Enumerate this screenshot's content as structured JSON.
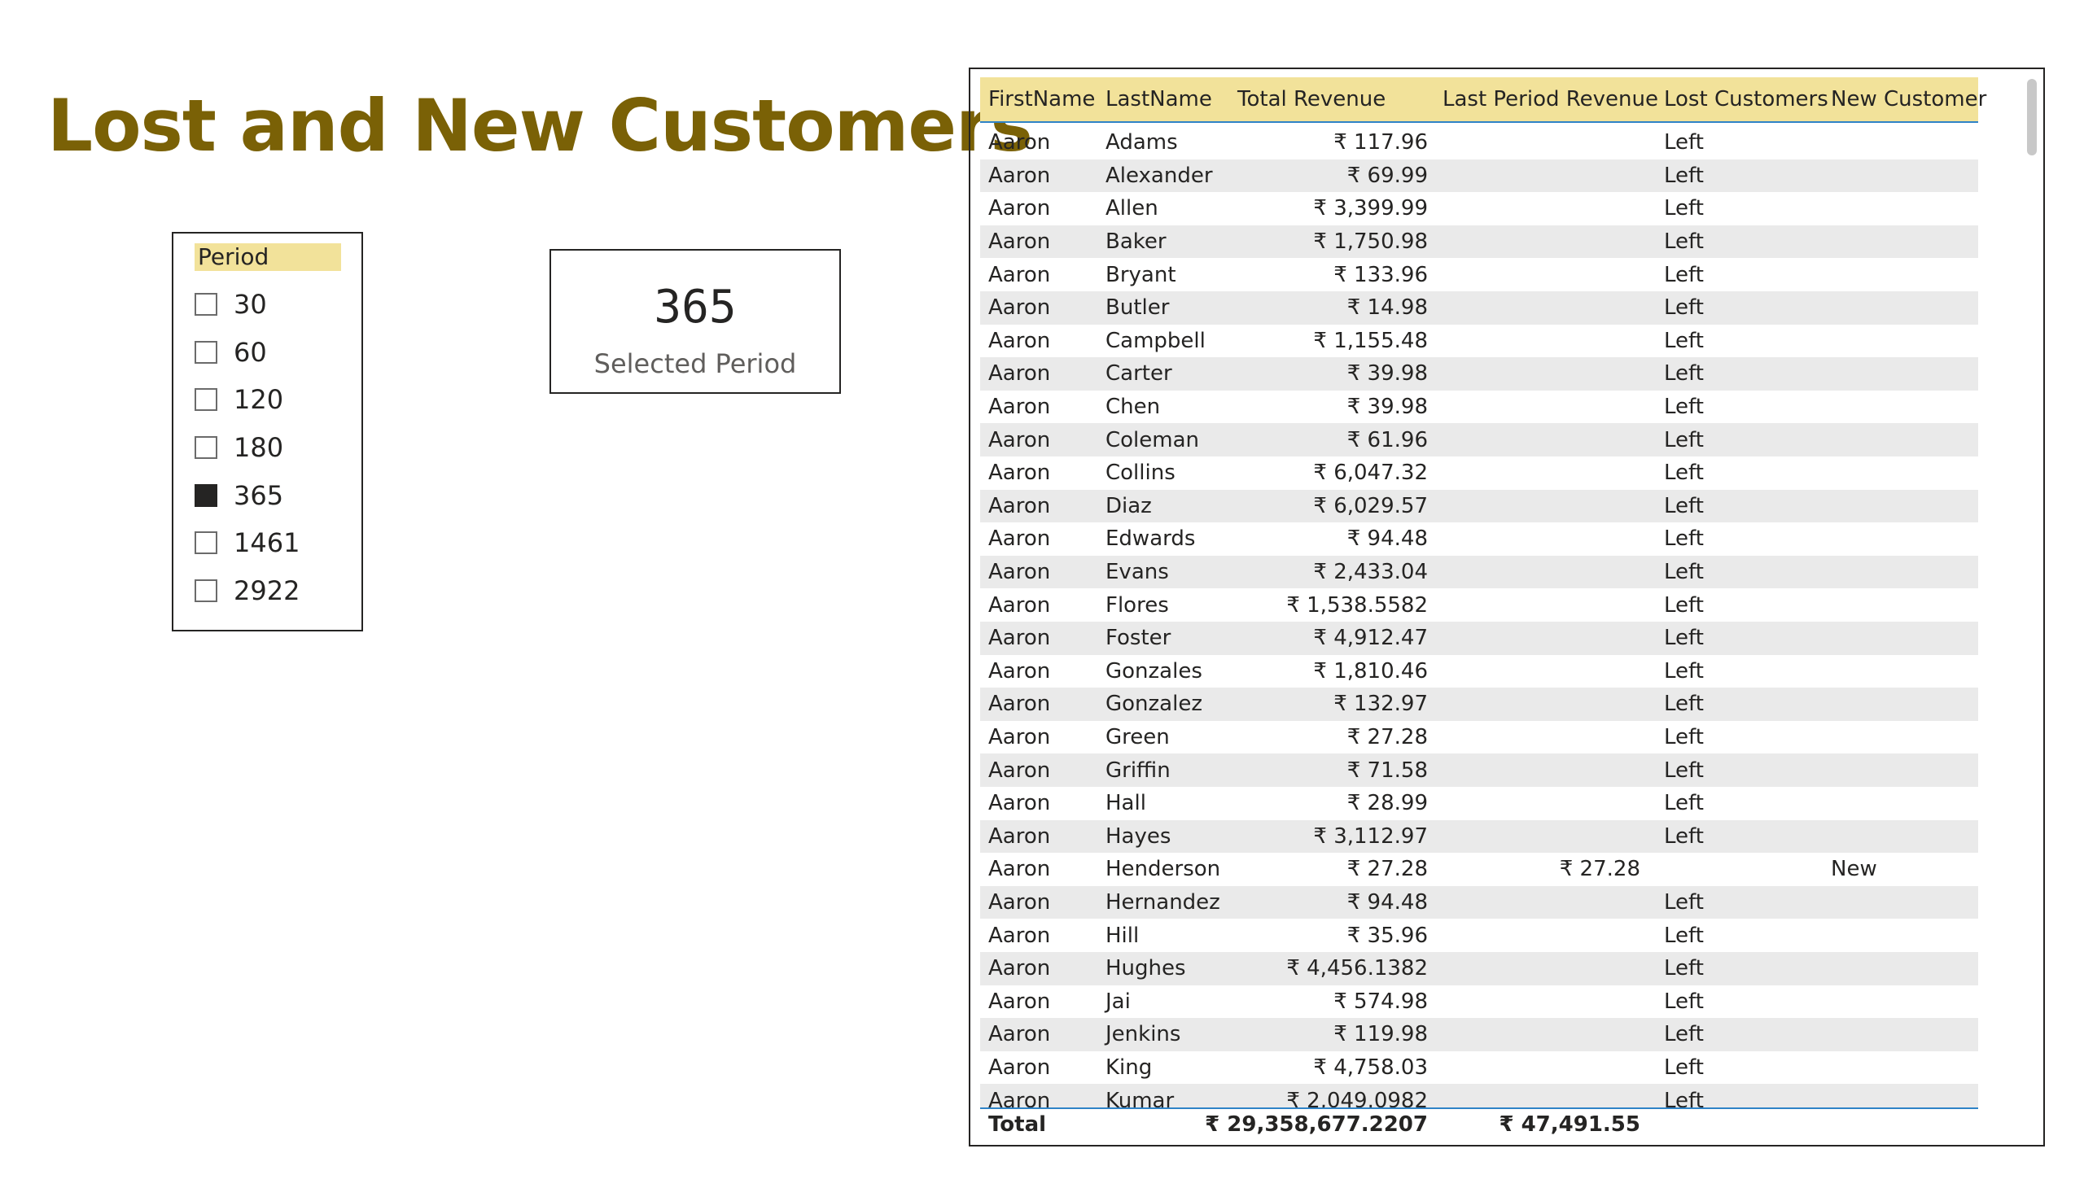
{
  "page": {
    "title": "Lost and New Customers"
  },
  "slicer": {
    "header": "Period",
    "items": [
      {
        "label": "30",
        "checked": false
      },
      {
        "label": "60",
        "checked": false
      },
      {
        "label": "120",
        "checked": false
      },
      {
        "label": "180",
        "checked": false
      },
      {
        "label": "365",
        "checked": true
      },
      {
        "label": "1461",
        "checked": false
      },
      {
        "label": "2922",
        "checked": false
      }
    ]
  },
  "card": {
    "value": "365",
    "label": "Selected Period"
  },
  "table": {
    "headers": [
      "FirstName",
      "LastName",
      "Total Revenue",
      "Last Period Revenue",
      "Lost Customers",
      "New Customer"
    ],
    "rows": [
      [
        "Aaron",
        "Adams",
        "₹ 117.96",
        "",
        "Left",
        ""
      ],
      [
        "Aaron",
        "Alexander",
        "₹ 69.99",
        "",
        "Left",
        ""
      ],
      [
        "Aaron",
        "Allen",
        "₹ 3,399.99",
        "",
        "Left",
        ""
      ],
      [
        "Aaron",
        "Baker",
        "₹ 1,750.98",
        "",
        "Left",
        ""
      ],
      [
        "Aaron",
        "Bryant",
        "₹ 133.96",
        "",
        "Left",
        ""
      ],
      [
        "Aaron",
        "Butler",
        "₹ 14.98",
        "",
        "Left",
        ""
      ],
      [
        "Aaron",
        "Campbell",
        "₹ 1,155.48",
        "",
        "Left",
        ""
      ],
      [
        "Aaron",
        "Carter",
        "₹ 39.98",
        "",
        "Left",
        ""
      ],
      [
        "Aaron",
        "Chen",
        "₹ 39.98",
        "",
        "Left",
        ""
      ],
      [
        "Aaron",
        "Coleman",
        "₹ 61.96",
        "",
        "Left",
        ""
      ],
      [
        "Aaron",
        "Collins",
        "₹ 6,047.32",
        "",
        "Left",
        ""
      ],
      [
        "Aaron",
        "Diaz",
        "₹ 6,029.57",
        "",
        "Left",
        ""
      ],
      [
        "Aaron",
        "Edwards",
        "₹ 94.48",
        "",
        "Left",
        ""
      ],
      [
        "Aaron",
        "Evans",
        "₹ 2,433.04",
        "",
        "Left",
        ""
      ],
      [
        "Aaron",
        "Flores",
        "₹ 1,538.5582",
        "",
        "Left",
        ""
      ],
      [
        "Aaron",
        "Foster",
        "₹ 4,912.47",
        "",
        "Left",
        ""
      ],
      [
        "Aaron",
        "Gonzales",
        "₹ 1,810.46",
        "",
        "Left",
        ""
      ],
      [
        "Aaron",
        "Gonzalez",
        "₹ 132.97",
        "",
        "Left",
        ""
      ],
      [
        "Aaron",
        "Green",
        "₹ 27.28",
        "",
        "Left",
        ""
      ],
      [
        "Aaron",
        "Griffin",
        "₹ 71.58",
        "",
        "Left",
        ""
      ],
      [
        "Aaron",
        "Hall",
        "₹ 28.99",
        "",
        "Left",
        ""
      ],
      [
        "Aaron",
        "Hayes",
        "₹ 3,112.97",
        "",
        "Left",
        ""
      ],
      [
        "Aaron",
        "Henderson",
        "₹ 27.28",
        "₹ 27.28",
        "",
        "New"
      ],
      [
        "Aaron",
        "Hernandez",
        "₹ 94.48",
        "",
        "Left",
        ""
      ],
      [
        "Aaron",
        "Hill",
        "₹ 35.96",
        "",
        "Left",
        ""
      ],
      [
        "Aaron",
        "Hughes",
        "₹ 4,456.1382",
        "",
        "Left",
        ""
      ],
      [
        "Aaron",
        "Jai",
        "₹ 574.98",
        "",
        "Left",
        ""
      ],
      [
        "Aaron",
        "Jenkins",
        "₹ 119.98",
        "",
        "Left",
        ""
      ],
      [
        "Aaron",
        "King",
        "₹ 4,758.03",
        "",
        "Left",
        ""
      ],
      [
        "Aaron",
        "Kumar",
        "₹ 2,049.0982",
        "",
        "Left",
        ""
      ]
    ],
    "total": {
      "label": "Total",
      "total_revenue": "₹ 29,358,677.2207",
      "last_period_revenue": "₹ 47,491.55"
    }
  },
  "colors": {
    "title": "#7a6106",
    "header_fill": "#f2e29a",
    "accent_line": "#2f83c7",
    "alt_row": "#eaeaea"
  }
}
